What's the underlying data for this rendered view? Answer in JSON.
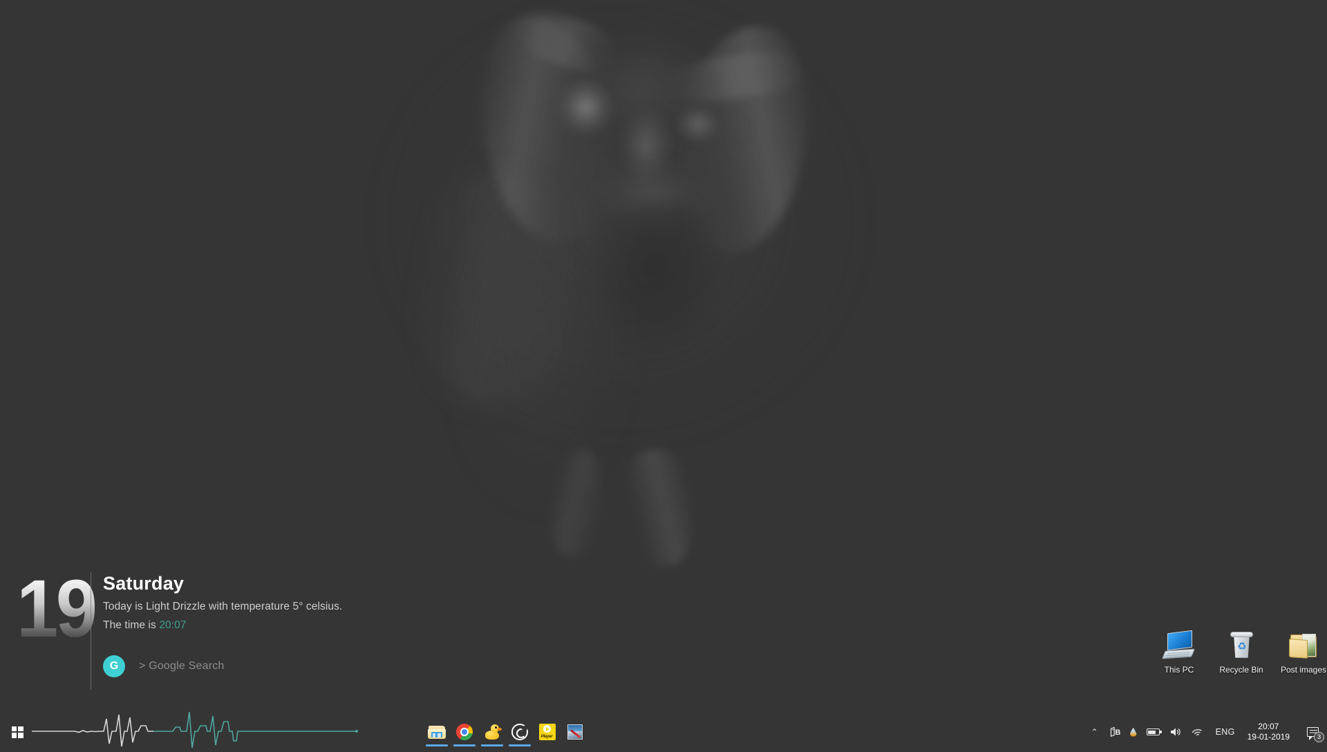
{
  "desktop": {
    "background_color": "#353535",
    "wallpaper_description": "Dark monochrome photograph of a woman with arms raised behind her head"
  },
  "date_widget": {
    "day_number": "19",
    "weekday": "Saturday",
    "weather_line": "Today is Light Drizzle with temperature 5° celsius.",
    "time_prefix": "The time is ",
    "time_value": "20:07",
    "time_color": "#3f9e8d",
    "search": {
      "badge_letter": "G",
      "badge_color": "#3fd0d4",
      "placeholder": "> Google Search"
    }
  },
  "desktop_icons": [
    {
      "name": "This PC",
      "icon": "computer-icon"
    },
    {
      "name": "Recycle Bin",
      "icon": "recycle-bin-icon"
    },
    {
      "name": "Post images",
      "icon": "folder-images-icon"
    }
  ],
  "taskbar": {
    "background_color": "#353535",
    "start_label": "Start",
    "start_icon": "windows-logo-icon",
    "waveform": {
      "left_color": "#d8d8d8",
      "right_color": "#4fa8a0",
      "description": "Audio visualizer waveform spanning the left taskbar"
    },
    "apps": [
      {
        "name": "File Explorer",
        "icon": "folder-icon",
        "running": true
      },
      {
        "name": "Google Chrome",
        "icon": "chrome-icon",
        "running": true
      },
      {
        "name": "Duck",
        "icon": "rubber-duck-icon",
        "running": true
      },
      {
        "name": "Media Player",
        "icon": "spiral-icon",
        "running": true
      },
      {
        "name": "Player",
        "icon": "player-icon",
        "running": false,
        "label": "Player"
      },
      {
        "name": "Image Editor",
        "icon": "image-editor-icon",
        "running": false
      }
    ]
  },
  "tray": {
    "chevron": "⌃",
    "items": [
      {
        "name": "bandizip-icon",
        "label": "B"
      },
      {
        "name": "flux-droplet-icon"
      },
      {
        "name": "battery-icon"
      },
      {
        "name": "volume-icon"
      },
      {
        "name": "wifi-icon"
      }
    ],
    "language": "ENG",
    "clock_time": "20:07",
    "clock_date": "19-01-2019",
    "action_center": {
      "icon": "notification-bubble-icon",
      "badge_count": "3"
    }
  }
}
